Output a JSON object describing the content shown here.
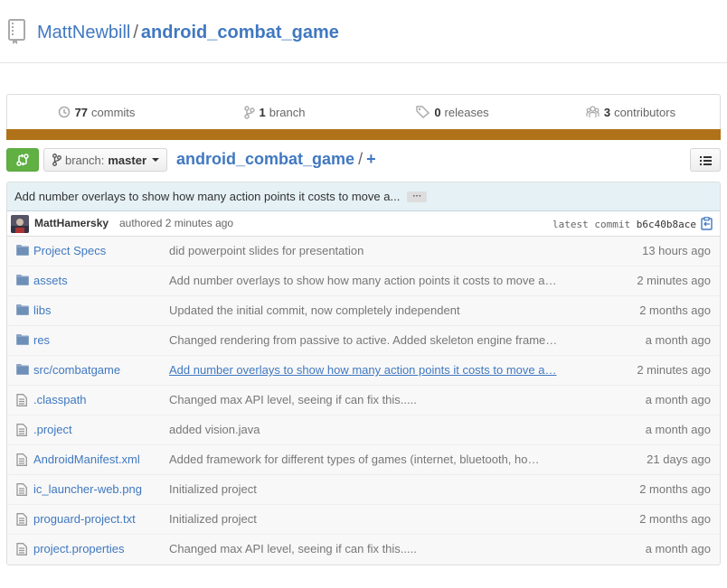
{
  "repo": {
    "owner": "MattNewbill",
    "separator": "/",
    "name": "android_combat_game"
  },
  "summary": {
    "commits": {
      "num": "77",
      "label": "commits"
    },
    "branches": {
      "num": "1",
      "label": "branch"
    },
    "releases": {
      "num": "0",
      "label": "releases"
    },
    "contributors": {
      "num": "3",
      "label": "contributors"
    },
    "language_color": "#b07219"
  },
  "toolbar": {
    "branch_label": "branch:",
    "branch_value": "master",
    "path_root": "android_combat_game",
    "path_slash": "/",
    "path_add": "+"
  },
  "commit": {
    "message": "Add number overlays to show how many action points it costs to move a...",
    "ellipsis": "···",
    "author": "MattHamersky",
    "authored": "authored 2 minutes ago",
    "latest_label": "latest commit",
    "sha": "b6c40b8ace"
  },
  "files": [
    {
      "type": "dir",
      "name": "Project Specs",
      "message": "did powerpoint slides for presentation",
      "age": "13 hours ago",
      "link": false
    },
    {
      "type": "dir",
      "name": "assets",
      "message": "Add number overlays to show how many action points it costs to move a…",
      "age": "2 minutes ago",
      "link": false
    },
    {
      "type": "dir",
      "name": "libs",
      "message": "Updated the initial commit, now completely independent",
      "age": "2 months ago",
      "link": false
    },
    {
      "type": "dir",
      "name": "res",
      "message": "Changed rendering from passive to active. Added skeleton engine frame…",
      "age": "a month ago",
      "link": false
    },
    {
      "type": "dir",
      "name": "src/combatgame",
      "message": "Add number overlays to show how many action points it costs to move a…",
      "age": "2 minutes ago",
      "link": true
    },
    {
      "type": "file",
      "name": ".classpath",
      "message": "Changed max API level, seeing if can fix this.....",
      "age": "a month ago",
      "link": false
    },
    {
      "type": "file",
      "name": ".project",
      "message": "added vision.java",
      "age": "a month ago",
      "link": false
    },
    {
      "type": "file",
      "name": "AndroidManifest.xml",
      "message": "Added framework for different types of games (internet, bluetooth, ho…",
      "age": "21 days ago",
      "link": false
    },
    {
      "type": "file",
      "name": "ic_launcher-web.png",
      "message": "Initialized project",
      "age": "2 months ago",
      "link": false
    },
    {
      "type": "file",
      "name": "proguard-project.txt",
      "message": "Initialized project",
      "age": "2 months ago",
      "link": false
    },
    {
      "type": "file",
      "name": "project.properties",
      "message": "Changed max API level, seeing if can fix this.....",
      "age": "a month ago",
      "link": false
    }
  ]
}
